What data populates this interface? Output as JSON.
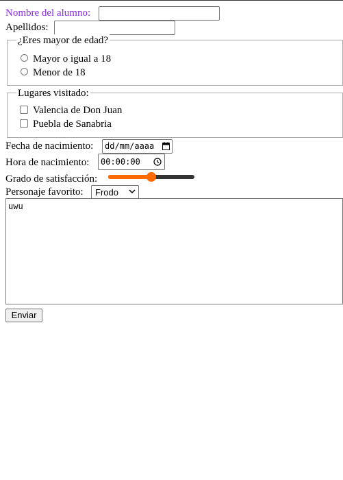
{
  "form": {
    "student_name": {
      "label": "Nombre del alumno:",
      "value": ""
    },
    "surnames": {
      "label": "Apellidos:",
      "value": ""
    },
    "age_group": {
      "legend": "¿Eres mayor de edad?",
      "options": [
        {
          "label": "Mayor o igual a 18",
          "checked": false
        },
        {
          "label": "Menor de 18",
          "checked": false
        }
      ]
    },
    "places": {
      "legend": "Lugares visitado:",
      "options": [
        {
          "label": "Valencia de Don Juan",
          "checked": false
        },
        {
          "label": "Puebla de Sanabria",
          "checked": false
        }
      ]
    },
    "birth_date": {
      "label": "Fecha de nacimiento:",
      "value": "dd/mm/aaaa",
      "icon": "calendar-icon"
    },
    "birth_time": {
      "label": "Hora de nacimiento:",
      "value": "00:00:00",
      "icon": "clock-icon"
    },
    "satisfaction": {
      "label": "Grado de satisfacción:",
      "value_fraction": 0.5
    },
    "favorite_character": {
      "label": "Personaje favorito:",
      "selected": "Frodo",
      "icon": "chevron-down-icon"
    },
    "comments": {
      "value": "uwu"
    },
    "submit": {
      "label": "Enviar"
    }
  },
  "colors": {
    "accent": "#ff6a00",
    "label_purple": "#8a2be2",
    "border": "#767676",
    "button_bg": "#efefef"
  }
}
